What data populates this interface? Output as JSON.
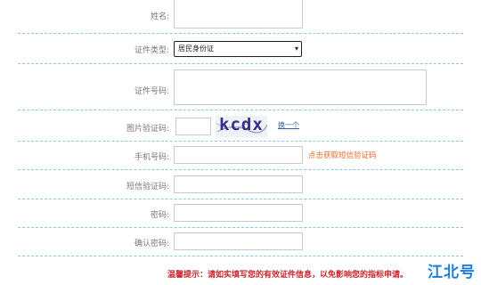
{
  "form": {
    "name": {
      "label": "姓名:",
      "value": ""
    },
    "id_type": {
      "label": "证件类型:",
      "selected": "居民身份证"
    },
    "id_number": {
      "label": "证件号码:",
      "value": ""
    },
    "captcha": {
      "label": "图片验证码:",
      "value": "",
      "image_text": "kcdx",
      "refresh_label": "换一个"
    },
    "phone": {
      "label": "手机号码:",
      "value": "",
      "sms_link": "点击获取短信验证码"
    },
    "sms_code": {
      "label": "短信验证码:",
      "value": ""
    },
    "password": {
      "label": "密码:",
      "value": ""
    },
    "confirm_password": {
      "label": "确认密码:",
      "value": ""
    }
  },
  "tip": "温馨提示：请如实填写您的有效证件信息，以免影响您的指标申请。",
  "watermark": "江北号",
  "colors": {
    "separator": "#8ec5e8",
    "tip": "#c8252c",
    "sms_link": "#e96b2a",
    "watermark": "#1c7fdc"
  }
}
